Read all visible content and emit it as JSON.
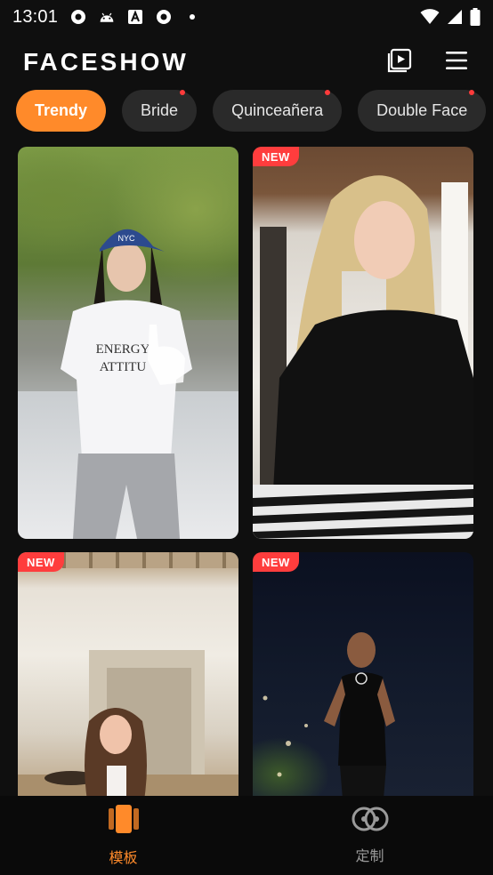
{
  "status_bar": {
    "time": "13:01"
  },
  "header": {
    "title": "FACESHOW"
  },
  "tabs": [
    {
      "label": "Trendy",
      "active": true,
      "dot": false
    },
    {
      "label": "Bride",
      "active": false,
      "dot": true
    },
    {
      "label": "Quinceañera",
      "active": false,
      "dot": true
    },
    {
      "label": "Double Face",
      "active": false,
      "dot": true
    }
  ],
  "cards": [
    {
      "badge": ""
    },
    {
      "badge": "NEW"
    },
    {
      "badge": "NEW"
    },
    {
      "badge": "NEW"
    }
  ],
  "card_text": {
    "cap_text": "NYC",
    "shirt_line1": "ENERGY",
    "shirt_line2": "ATTITU"
  },
  "bottom_nav": {
    "items": [
      {
        "label": "模板",
        "icon": "template-icon",
        "active": true
      },
      {
        "label": "定制",
        "icon": "custom-icon",
        "active": false
      }
    ]
  },
  "colors": {
    "accent": "#ff8a2a",
    "badge": "#ff3d3d",
    "background": "#0f0f0f"
  }
}
